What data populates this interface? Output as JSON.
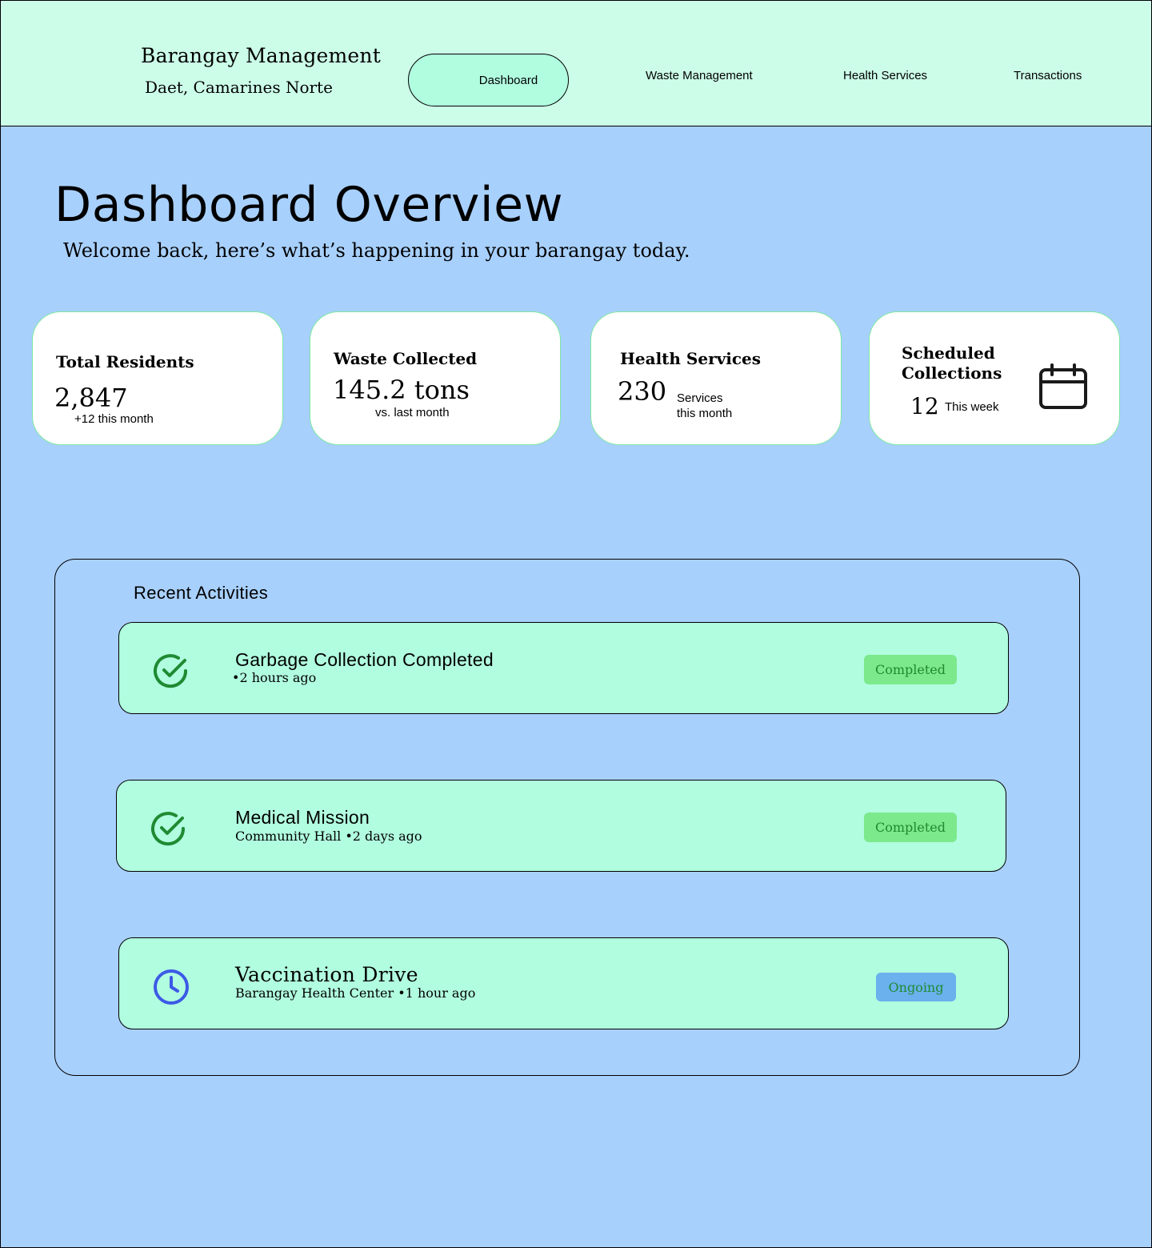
{
  "header": {
    "brand_title": "Barangay Management",
    "brand_subtitle": "Daet, Camarines Norte",
    "nav": [
      "Dashboard",
      "Waste Management",
      "Health Services",
      "Transactions"
    ]
  },
  "page": {
    "title": "Dashboard Overview",
    "subtitle": "Welcome back, here’s what’s happening in your barangay today."
  },
  "stats": {
    "residents": {
      "label": "Total Residents",
      "value": "2,847",
      "note": "+12 this month"
    },
    "waste": {
      "label": "Waste Collected",
      "value": "145.2 tons",
      "note": "vs. last month"
    },
    "health": {
      "label": "Health Services",
      "value": "230",
      "note_line1": "Services",
      "note_line2": "this month"
    },
    "collections": {
      "label_line1": "Scheduled",
      "label_line2": "Collections",
      "value": "12",
      "note": "This week",
      "icon": "calendar-icon"
    }
  },
  "activities": {
    "title": "Recent Activities",
    "items": [
      {
        "title": "Garbage Collection Completed",
        "meta": "•2 hours ago",
        "status": "Completed",
        "icon": "check-circle-icon"
      },
      {
        "title": "Medical Mission",
        "meta": "Community Hall •2 days ago",
        "status": "Completed",
        "icon": "check-circle-icon"
      },
      {
        "title": "Vaccination Drive",
        "meta": "Barangay Health Center •1 hour ago",
        "status": "Ongoing",
        "icon": "clock-icon"
      }
    ]
  },
  "colors": {
    "background": "#a8d0fd",
    "header": "#ccfde9",
    "activity_card": "#b1fde0",
    "badge_completed": "#7ce98c",
    "badge_ongoing": "#6ab1ee",
    "check_icon": "#1f8a32",
    "clock_icon": "#3c5ae6"
  }
}
